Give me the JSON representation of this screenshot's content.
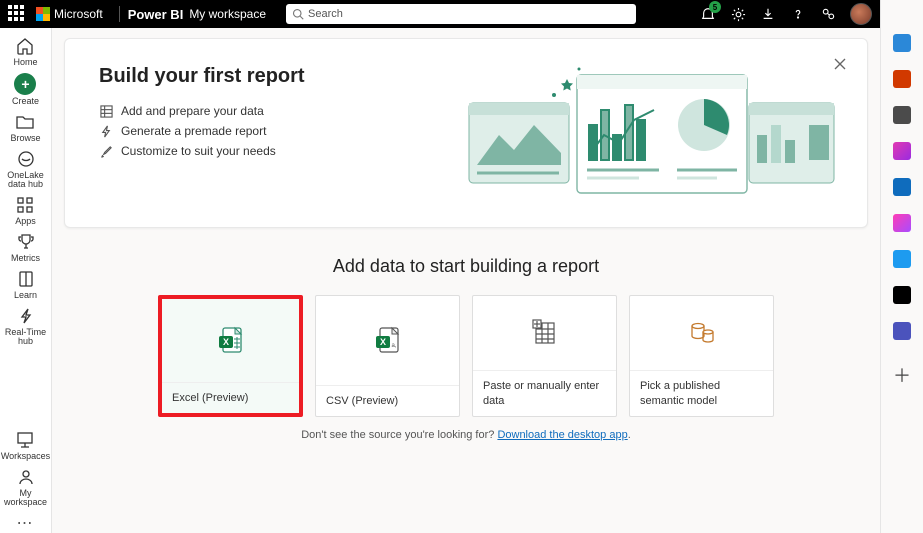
{
  "header": {
    "brand": "Microsoft",
    "product": "Power BI",
    "workspace": "My workspace",
    "search_placeholder": "Search",
    "notif_count": "5"
  },
  "rail": {
    "home": "Home",
    "create": "Create",
    "browse": "Browse",
    "onelake": "OneLake\ndata hub",
    "apps": "Apps",
    "metrics": "Metrics",
    "learn": "Learn",
    "realtime": "Real-Time\nhub",
    "workspaces": "Workspaces",
    "myws": "My\nworkspace"
  },
  "hero": {
    "title": "Build your first report",
    "b1": "Add and prepare your data",
    "b2": "Generate a premade report",
    "b3": "Customize to suit your needs"
  },
  "section_title": "Add data to start building a report",
  "cards": {
    "excel": "Excel (Preview)",
    "csv": "CSV (Preview)",
    "paste": "Paste or manually enter data",
    "semantic": "Pick a published semantic model"
  },
  "footer": {
    "lead": "Don't see the source you're looking for? ",
    "link": "Download the desktop app",
    "tail": "."
  }
}
